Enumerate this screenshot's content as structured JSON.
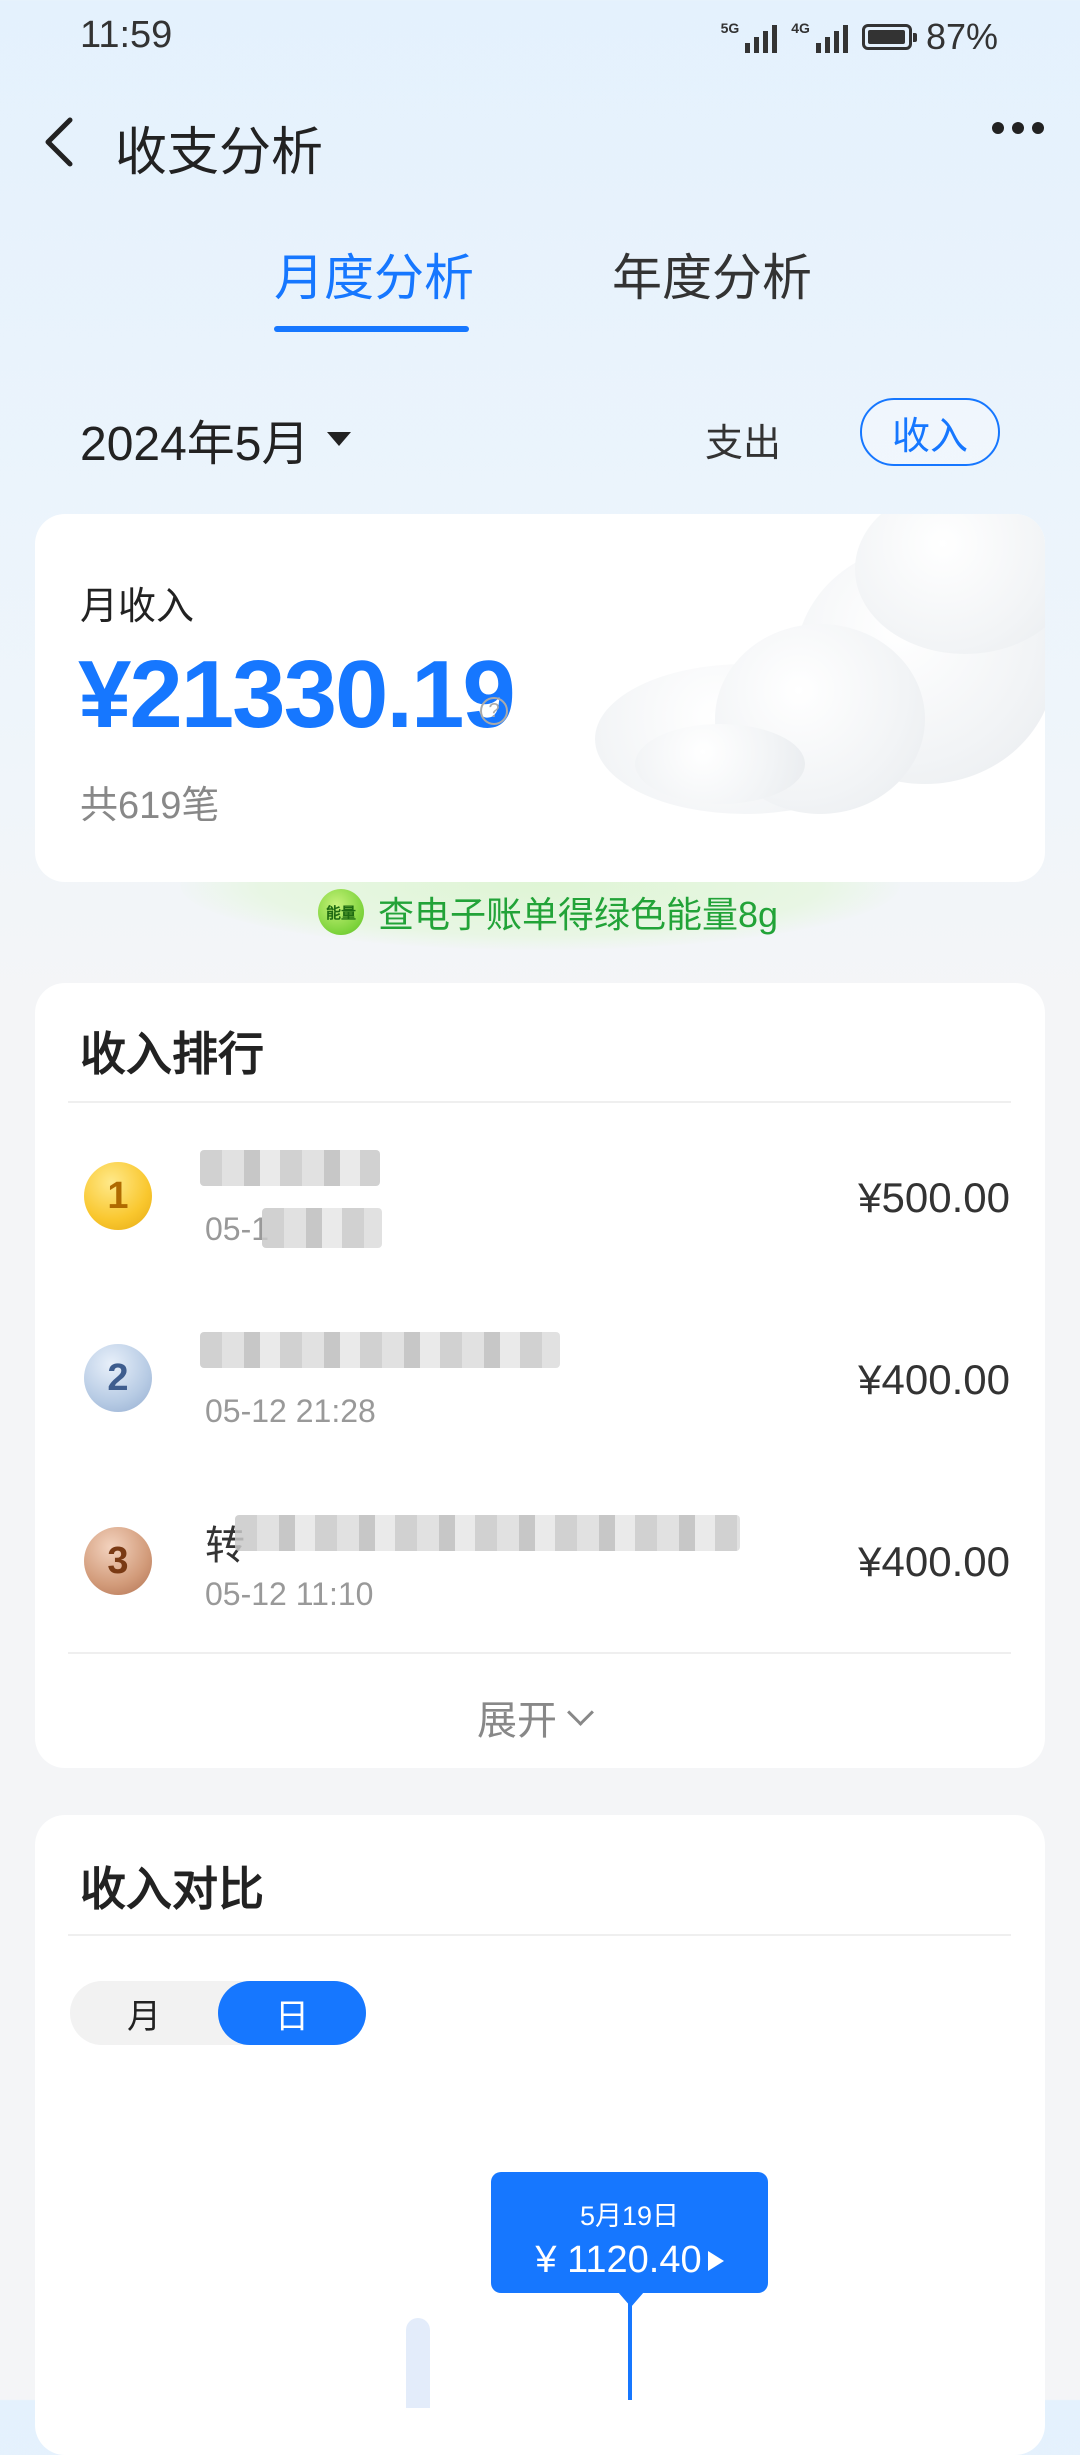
{
  "status": {
    "time": "11:59",
    "signal1": "5G",
    "signal2": "4G",
    "battery": "87%",
    "battery_level": 0.87
  },
  "header": {
    "title": "收支分析"
  },
  "tabs": [
    {
      "label": "月度分析",
      "active": true
    },
    {
      "label": "年度分析",
      "active": false
    }
  ],
  "filter": {
    "period": "2024年5月",
    "expense_label": "支出",
    "income_label": "收入",
    "selected": "收入"
  },
  "summary": {
    "label": "月收入",
    "amount": "¥21330.19",
    "count": "共619笔"
  },
  "promo": {
    "badge": "能量",
    "text": "查电子账单得绿色能量8g"
  },
  "ranking": {
    "title": "收入排行",
    "rows": [
      {
        "rank": "1",
        "title": "",
        "time": "05-1",
        "amount": "¥500.00"
      },
      {
        "rank": "2",
        "title": "",
        "time": "05-12 21:28",
        "amount": "¥400.00"
      },
      {
        "rank": "3",
        "title": "转",
        "time": "05-12 11:10",
        "amount": "¥400.00"
      }
    ],
    "expand_label": "展开"
  },
  "comparison": {
    "title": "收入对比",
    "toggle": {
      "month": "月",
      "day": "日",
      "selected": "日"
    },
    "tooltip": {
      "date": "5月19日",
      "value": "¥ 1120.40"
    }
  },
  "colors": {
    "accent": "#1677ff",
    "promo_green": "#22a338"
  }
}
